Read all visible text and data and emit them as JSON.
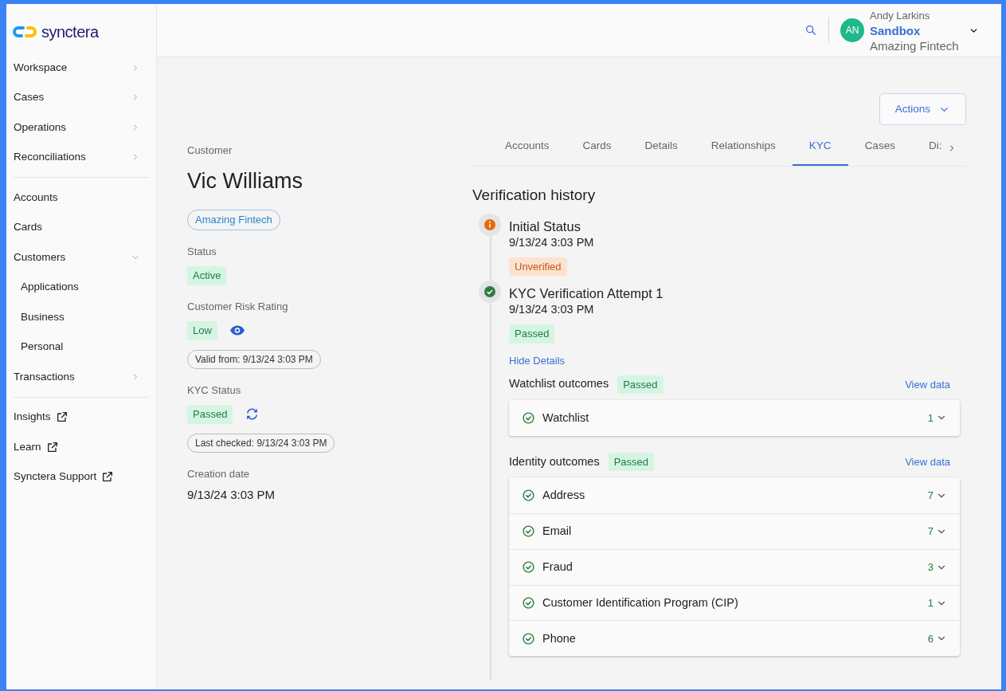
{
  "logo": {
    "text": "synctera"
  },
  "sidebar": {
    "groups": [
      [
        {
          "label": "Workspace",
          "kind": "collapsed"
        },
        {
          "label": "Cases",
          "kind": "collapsed"
        },
        {
          "label": "Operations",
          "kind": "collapsed"
        },
        {
          "label": "Reconciliations",
          "kind": "collapsed"
        }
      ],
      [
        {
          "label": "Accounts",
          "kind": "plain"
        },
        {
          "label": "Cards",
          "kind": "plain"
        },
        {
          "label": "Customers",
          "kind": "expanded",
          "children": [
            {
              "label": "Applications"
            },
            {
              "label": "Business"
            },
            {
              "label": "Personal"
            }
          ]
        },
        {
          "label": "Transactions",
          "kind": "collapsed"
        }
      ],
      [
        {
          "label": "Insights",
          "kind": "external"
        },
        {
          "label": "Learn",
          "kind": "external"
        },
        {
          "label": "Synctera Support",
          "kind": "external"
        }
      ]
    ]
  },
  "header": {
    "user": {
      "initials": "AN",
      "name": "Andy Larkins",
      "environment": "Sandbox",
      "organization": "Amazing Fintech"
    }
  },
  "actions_button": "Actions",
  "customer": {
    "caption": "Customer",
    "name": "Vic Williams",
    "tag": "Amazing Fintech",
    "fields": [
      {
        "label": "Status",
        "badge": {
          "text": "Active",
          "kind": "success"
        }
      },
      {
        "label": "Customer Risk Rating",
        "badge": {
          "text": "Low",
          "kind": "success"
        },
        "action": {
          "kind": "view"
        },
        "note": "Valid from: 9/13/24 3:03 PM"
      },
      {
        "label": "KYC Status",
        "badge": {
          "text": "Passed",
          "kind": "success"
        },
        "action": {
          "kind": "refresh"
        },
        "note": "Last checked: 9/13/24 3:03 PM"
      },
      {
        "label": "Creation date",
        "value": "9/13/24 3:03 PM"
      }
    ]
  },
  "tabs": [
    {
      "label": "Accounts",
      "selected": false
    },
    {
      "label": "Cards",
      "selected": false
    },
    {
      "label": "Details",
      "selected": false
    },
    {
      "label": "Relationships",
      "selected": false
    },
    {
      "label": "KYC",
      "selected": true
    },
    {
      "label": "Cases",
      "selected": false
    },
    {
      "label": "Di:",
      "selected": false
    }
  ],
  "verification": {
    "title": "Verification history",
    "events": [
      {
        "title": "Initial Status",
        "time": "9/13/24 3:03 PM",
        "kind": "info",
        "badge": {
          "text": "Unverified",
          "kind": "warning"
        }
      },
      {
        "title": "KYC Verification Attempt 1",
        "time": "9/13/24 3:03 PM",
        "kind": "success",
        "badge": {
          "text": "Passed",
          "kind": "success"
        },
        "details_link": "Hide Details",
        "sections": [
          {
            "title": "Watchlist outcomes",
            "badge": {
              "text": "Passed",
              "kind": "success"
            },
            "link": "View data",
            "rows": [
              {
                "label": "Watchlist",
                "count": "1"
              }
            ]
          },
          {
            "title": "Identity outcomes",
            "badge": {
              "text": "Passed",
              "kind": "success"
            },
            "link": "View data",
            "rows": [
              {
                "label": "Address",
                "count": "7"
              },
              {
                "label": "Email",
                "count": "7"
              },
              {
                "label": "Fraud",
                "count": "3"
              },
              {
                "label": "Customer Identification Program (CIP)",
                "count": "1"
              },
              {
                "label": "Phone",
                "count": "6"
              }
            ]
          }
        ]
      }
    ]
  }
}
